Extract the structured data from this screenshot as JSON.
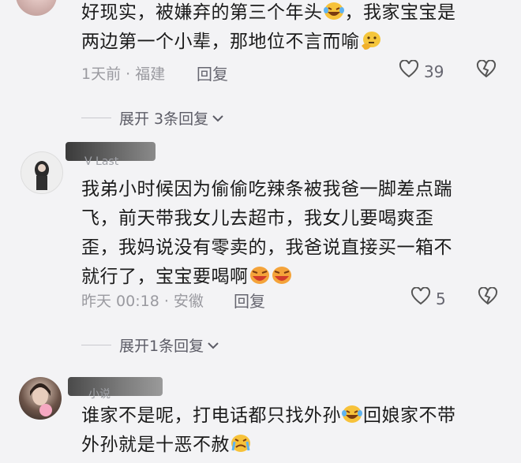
{
  "comments": [
    {
      "text_line1": "好现实，被嫌弃的第三个年头",
      "text_line1b": "，我家宝宝是",
      "text_line2": "两边第一个小辈，那地位不言而喻",
      "meta": "1天前 · 福建",
      "reply_label": "回复",
      "likes": "39",
      "expand_label": "展开 3条回复"
    },
    {
      "username_hint": "V Last",
      "text_line1": "我弟小时候因为偷偷吃辣条被我爸一脚差点踹",
      "text_line2": "飞，前天带我女儿去超市，我女儿要喝爽歪",
      "text_line3": "歪，我妈说没有零卖的，我爸说直接买一箱不",
      "text_line4": "就行了，宝宝要喝啊",
      "meta": "昨天 00:18 · 安徽",
      "reply_label": "回复",
      "likes": "5",
      "expand_label": "展开1条回复"
    },
    {
      "username_hint": "小说",
      "text_line1": "谁家不是呢，打电话都只找外孙",
      "text_line1b": "回娘家不带",
      "text_line2": "外孙就是十恶不赦"
    }
  ],
  "icons": {
    "heart": "heart-outline-icon",
    "broken_heart": "broken-heart-icon",
    "chevron": "chevron-down-icon"
  }
}
